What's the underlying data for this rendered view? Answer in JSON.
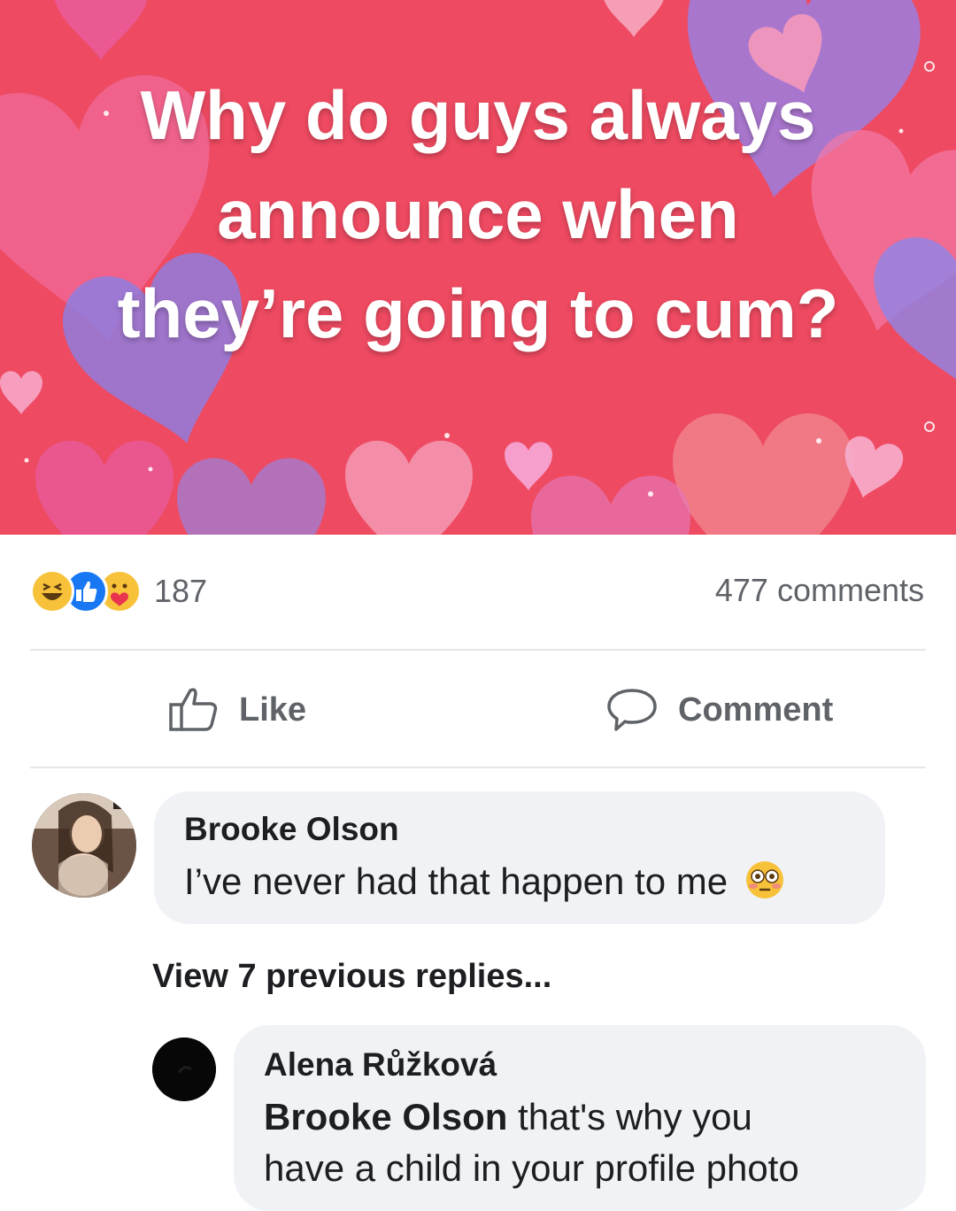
{
  "post": {
    "image_text": [
      "Why do guys always",
      "announce when",
      "they’re going to cum?"
    ],
    "background_color": "#ee4a61"
  },
  "reactions": {
    "icons": [
      "haha-icon",
      "like-icon",
      "care-icon"
    ],
    "count": "187"
  },
  "comments_count": "477 comments",
  "actions": {
    "like_label": "Like",
    "comment_label": "Comment"
  },
  "comments": [
    {
      "author": "Brooke Olson",
      "text": "I’ve never had that happen to me",
      "emoji": "flushed-face-icon"
    }
  ],
  "view_replies": "View 7 previous replies...",
  "reply": {
    "author": "Alena Růžková",
    "mention": "Brooke Olson",
    "text_line1": " that's why you",
    "text_line2": "have a child in your profile photo"
  }
}
